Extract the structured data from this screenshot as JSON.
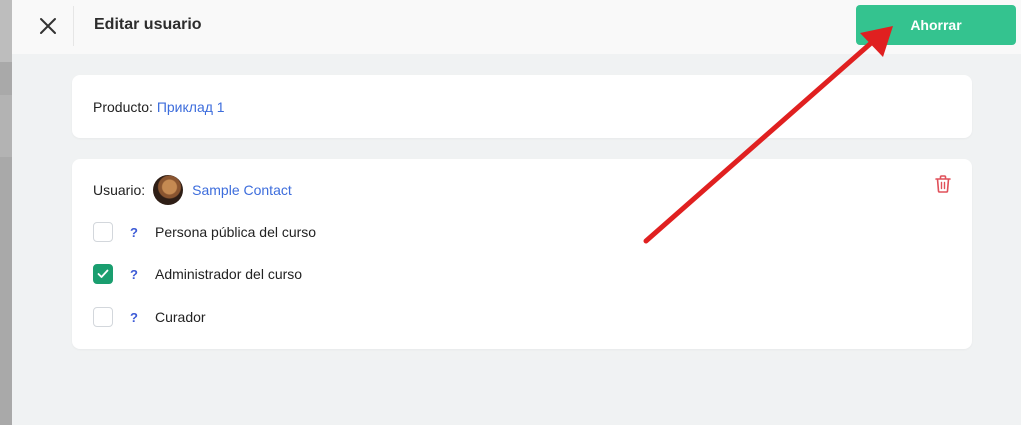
{
  "header": {
    "title": "Editar usuario",
    "save_label": "Ahorrar",
    "accent_color": "#34c38f"
  },
  "product": {
    "label": "Producto:",
    "value": "Приклад 1"
  },
  "user": {
    "label": "Usuario:",
    "name": "Sample Contact",
    "permissions": [
      {
        "label": "Persona pública del curso",
        "checked": false
      },
      {
        "label": "Administrador del curso",
        "checked": true
      },
      {
        "label": "Curador",
        "checked": false
      }
    ],
    "help_glyph": "?"
  },
  "icons": {
    "close": "close-icon",
    "delete": "trash-icon",
    "help": "question-icon",
    "check": "check-icon"
  },
  "annotation": {
    "arrow_color": "#e02020"
  }
}
